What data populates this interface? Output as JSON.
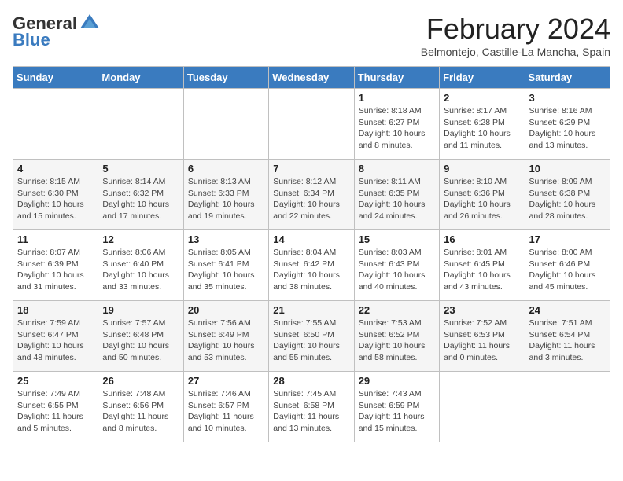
{
  "header": {
    "logo_general": "General",
    "logo_blue": "Blue",
    "month_title": "February 2024",
    "subtitle": "Belmontejo, Castille-La Mancha, Spain"
  },
  "days_of_week": [
    "Sunday",
    "Monday",
    "Tuesday",
    "Wednesday",
    "Thursday",
    "Friday",
    "Saturday"
  ],
  "weeks": [
    [
      {
        "day": "",
        "info": ""
      },
      {
        "day": "",
        "info": ""
      },
      {
        "day": "",
        "info": ""
      },
      {
        "day": "",
        "info": ""
      },
      {
        "day": "1",
        "info": "Sunrise: 8:18 AM\nSunset: 6:27 PM\nDaylight: 10 hours and 8 minutes."
      },
      {
        "day": "2",
        "info": "Sunrise: 8:17 AM\nSunset: 6:28 PM\nDaylight: 10 hours and 11 minutes."
      },
      {
        "day": "3",
        "info": "Sunrise: 8:16 AM\nSunset: 6:29 PM\nDaylight: 10 hours and 13 minutes."
      }
    ],
    [
      {
        "day": "4",
        "info": "Sunrise: 8:15 AM\nSunset: 6:30 PM\nDaylight: 10 hours and 15 minutes."
      },
      {
        "day": "5",
        "info": "Sunrise: 8:14 AM\nSunset: 6:32 PM\nDaylight: 10 hours and 17 minutes."
      },
      {
        "day": "6",
        "info": "Sunrise: 8:13 AM\nSunset: 6:33 PM\nDaylight: 10 hours and 19 minutes."
      },
      {
        "day": "7",
        "info": "Sunrise: 8:12 AM\nSunset: 6:34 PM\nDaylight: 10 hours and 22 minutes."
      },
      {
        "day": "8",
        "info": "Sunrise: 8:11 AM\nSunset: 6:35 PM\nDaylight: 10 hours and 24 minutes."
      },
      {
        "day": "9",
        "info": "Sunrise: 8:10 AM\nSunset: 6:36 PM\nDaylight: 10 hours and 26 minutes."
      },
      {
        "day": "10",
        "info": "Sunrise: 8:09 AM\nSunset: 6:38 PM\nDaylight: 10 hours and 28 minutes."
      }
    ],
    [
      {
        "day": "11",
        "info": "Sunrise: 8:07 AM\nSunset: 6:39 PM\nDaylight: 10 hours and 31 minutes."
      },
      {
        "day": "12",
        "info": "Sunrise: 8:06 AM\nSunset: 6:40 PM\nDaylight: 10 hours and 33 minutes."
      },
      {
        "day": "13",
        "info": "Sunrise: 8:05 AM\nSunset: 6:41 PM\nDaylight: 10 hours and 35 minutes."
      },
      {
        "day": "14",
        "info": "Sunrise: 8:04 AM\nSunset: 6:42 PM\nDaylight: 10 hours and 38 minutes."
      },
      {
        "day": "15",
        "info": "Sunrise: 8:03 AM\nSunset: 6:43 PM\nDaylight: 10 hours and 40 minutes."
      },
      {
        "day": "16",
        "info": "Sunrise: 8:01 AM\nSunset: 6:45 PM\nDaylight: 10 hours and 43 minutes."
      },
      {
        "day": "17",
        "info": "Sunrise: 8:00 AM\nSunset: 6:46 PM\nDaylight: 10 hours and 45 minutes."
      }
    ],
    [
      {
        "day": "18",
        "info": "Sunrise: 7:59 AM\nSunset: 6:47 PM\nDaylight: 10 hours and 48 minutes."
      },
      {
        "day": "19",
        "info": "Sunrise: 7:57 AM\nSunset: 6:48 PM\nDaylight: 10 hours and 50 minutes."
      },
      {
        "day": "20",
        "info": "Sunrise: 7:56 AM\nSunset: 6:49 PM\nDaylight: 10 hours and 53 minutes."
      },
      {
        "day": "21",
        "info": "Sunrise: 7:55 AM\nSunset: 6:50 PM\nDaylight: 10 hours and 55 minutes."
      },
      {
        "day": "22",
        "info": "Sunrise: 7:53 AM\nSunset: 6:52 PM\nDaylight: 10 hours and 58 minutes."
      },
      {
        "day": "23",
        "info": "Sunrise: 7:52 AM\nSunset: 6:53 PM\nDaylight: 11 hours and 0 minutes."
      },
      {
        "day": "24",
        "info": "Sunrise: 7:51 AM\nSunset: 6:54 PM\nDaylight: 11 hours and 3 minutes."
      }
    ],
    [
      {
        "day": "25",
        "info": "Sunrise: 7:49 AM\nSunset: 6:55 PM\nDaylight: 11 hours and 5 minutes."
      },
      {
        "day": "26",
        "info": "Sunrise: 7:48 AM\nSunset: 6:56 PM\nDaylight: 11 hours and 8 minutes."
      },
      {
        "day": "27",
        "info": "Sunrise: 7:46 AM\nSunset: 6:57 PM\nDaylight: 11 hours and 10 minutes."
      },
      {
        "day": "28",
        "info": "Sunrise: 7:45 AM\nSunset: 6:58 PM\nDaylight: 11 hours and 13 minutes."
      },
      {
        "day": "29",
        "info": "Sunrise: 7:43 AM\nSunset: 6:59 PM\nDaylight: 11 hours and 15 minutes."
      },
      {
        "day": "",
        "info": ""
      },
      {
        "day": "",
        "info": ""
      }
    ]
  ]
}
